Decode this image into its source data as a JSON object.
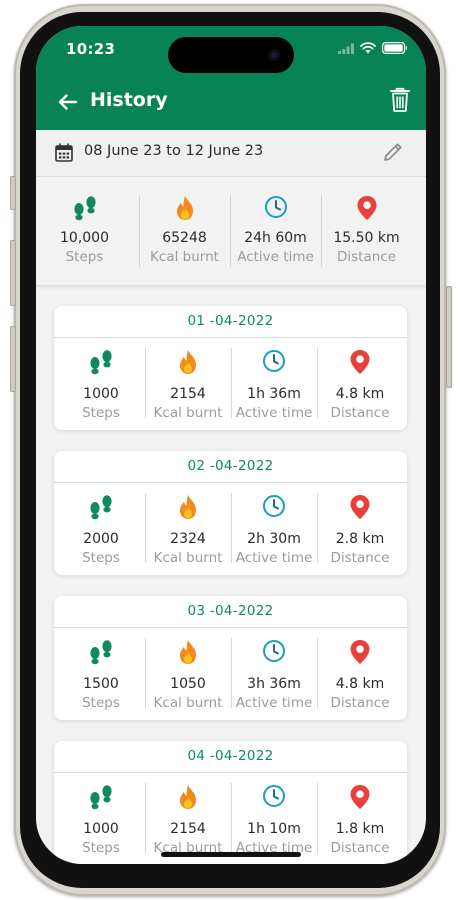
{
  "status": {
    "time": "10:23"
  },
  "header": {
    "title": "History"
  },
  "date_range": "08 June 23 to 12 June 23",
  "summary": [
    {
      "value": "10,000",
      "label": "Steps",
      "icon": "footsteps-icon"
    },
    {
      "value": "65248",
      "label": "Kcal burnt",
      "icon": "fire-icon"
    },
    {
      "value": "24h 60m",
      "label": "Active time",
      "icon": "clock-icon"
    },
    {
      "value": "15.50 km",
      "label": "Distance",
      "icon": "location-pin-icon"
    }
  ],
  "days": [
    {
      "date": "01 -04-2022",
      "stats": [
        {
          "value": "1000",
          "label": "Steps"
        },
        {
          "value": "2154",
          "label": "Kcal burnt"
        },
        {
          "value": "1h 36m",
          "label": "Active time"
        },
        {
          "value": "4.8 km",
          "label": "Distance"
        }
      ]
    },
    {
      "date": "02 -04-2022",
      "stats": [
        {
          "value": "2000",
          "label": "Steps"
        },
        {
          "value": "2324",
          "label": "Kcal burnt"
        },
        {
          "value": "2h 30m",
          "label": "Active time"
        },
        {
          "value": "2.8 km",
          "label": "Distance"
        }
      ]
    },
    {
      "date": "03 -04-2022",
      "stats": [
        {
          "value": "1500",
          "label": "Steps"
        },
        {
          "value": "1050",
          "label": "Kcal burnt"
        },
        {
          "value": "3h 36m",
          "label": "Active time"
        },
        {
          "value": "4.8 km",
          "label": "Distance"
        }
      ]
    },
    {
      "date": "04 -04-2022",
      "stats": [
        {
          "value": "1000",
          "label": "Steps"
        },
        {
          "value": "2154",
          "label": "Kcal burnt"
        },
        {
          "value": "1h 10m",
          "label": "Active time"
        },
        {
          "value": "1.8 km",
          "label": "Distance"
        }
      ]
    }
  ],
  "colors": {
    "primary": "#078356",
    "date_text": "#0f8a5f",
    "fire": "#f28a1c",
    "clock": "#1aa0b8",
    "pin": "#e8413c"
  }
}
